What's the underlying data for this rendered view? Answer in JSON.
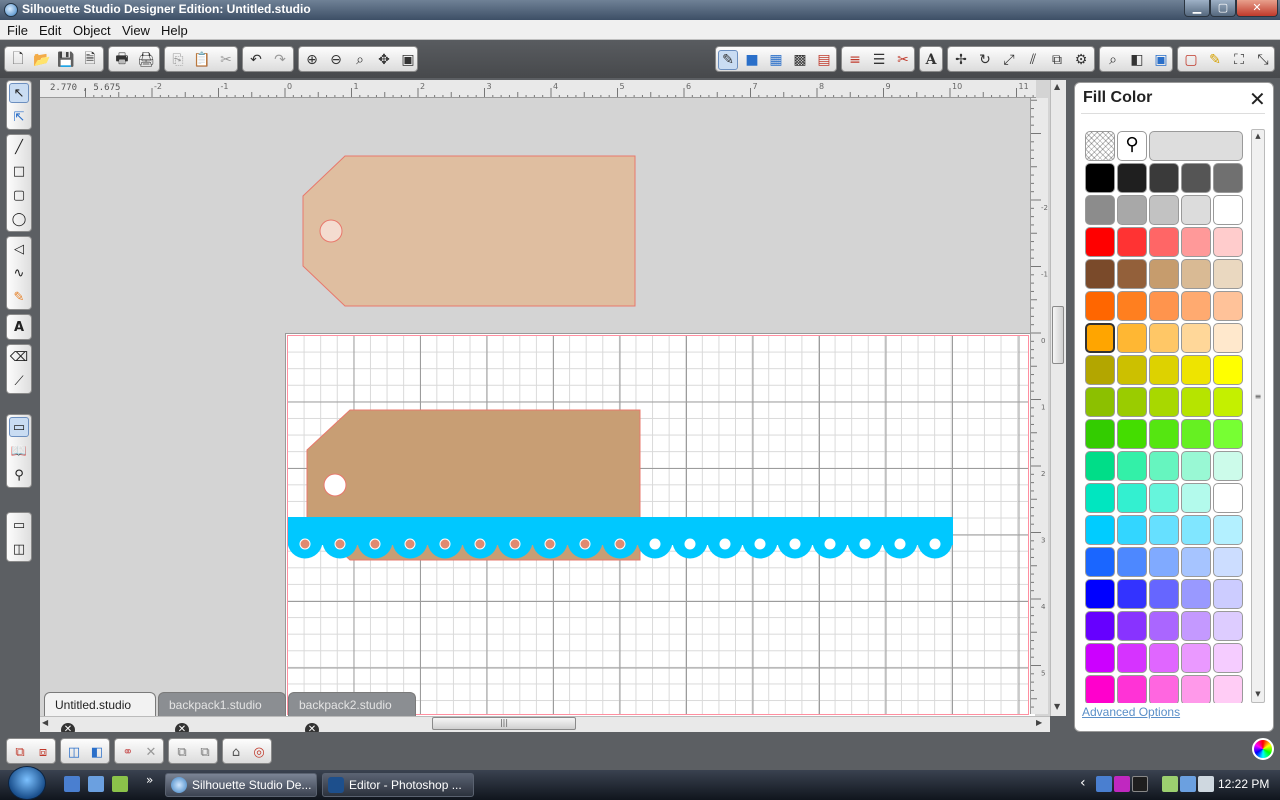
{
  "window": {
    "title": "Silhouette Studio Designer Edition: Untitled.studio",
    "min_label": "▁",
    "max_label": "▢",
    "close_label": "✕"
  },
  "menu": [
    "File",
    "Edit",
    "Object",
    "View",
    "Help"
  ],
  "ruler": {
    "coords": "2.770 , 5.675",
    "h_labels": [
      "-2",
      "-1",
      "0",
      "1",
      "2",
      "3",
      "4",
      "5",
      "6",
      "7",
      "8",
      "9",
      "10",
      "11"
    ],
    "v_labels": [
      "-2",
      "-1",
      "0",
      "1",
      "2",
      "3",
      "4",
      "5"
    ]
  },
  "tabs": [
    {
      "label": "Untitled.studio",
      "active": true
    },
    {
      "label": "backpack1.studio",
      "active": false
    },
    {
      "label": "backpack2.studio",
      "active": false
    }
  ],
  "fill_panel": {
    "title": "Fill Color",
    "close": "✕",
    "advanced": "Advanced Options",
    "selected_swatch": "#FFA500",
    "top_row": [
      "transparent",
      "eyedropper",
      "#DDDDDD"
    ],
    "palette": [
      [
        "#000000",
        "#1F1F1F",
        "#3A3A3A",
        "#555555",
        "#707070"
      ],
      [
        "#8C8C8C",
        "#A8A8A8",
        "#C2C2C2",
        "#DCDCDC",
        "#FFFFFF"
      ],
      [
        "#FF0000",
        "#FF3333",
        "#FF6666",
        "#FF9999",
        "#FFCCCC"
      ],
      [
        "#7A4A2A",
        "#93603A",
        "#C69C6D",
        "#D9BA94",
        "#EAD8C0"
      ],
      [
        "#FF6600",
        "#FF7F1F",
        "#FF944D",
        "#FFAA70",
        "#FFC299"
      ],
      [
        "#FFA500",
        "#FFB733",
        "#FFC766",
        "#FFD799",
        "#FFE8CC"
      ],
      [
        "#B3A600",
        "#CCC000",
        "#DDD200",
        "#EEE400",
        "#FFFF00"
      ],
      [
        "#8CC000",
        "#9ACC00",
        "#A8D800",
        "#B6E400",
        "#C4F000"
      ],
      [
        "#33CC00",
        "#44DD00",
        "#55E611",
        "#66F022",
        "#77FF33"
      ],
      [
        "#00DD88",
        "#33F0A8",
        "#66F5BF",
        "#99F8D4",
        "#CCFBEA"
      ],
      [
        "#00E6C0",
        "#33F0D0",
        "#66F5DC",
        "#B3FAEC",
        "#FFFFFF"
      ],
      [
        "#00CCFF",
        "#33D6FF",
        "#66E0FF",
        "#80E6FF",
        "#B3F0FF"
      ],
      [
        "#1A66FF",
        "#4D88FF",
        "#80AAFF",
        "#A6C4FF",
        "#CCDDFF"
      ],
      [
        "#0000FF",
        "#3333FF",
        "#6666FF",
        "#9999FF",
        "#CCCCFF"
      ],
      [
        "#6600FF",
        "#8833FF",
        "#AA66FF",
        "#C499FF",
        "#DDCCFF"
      ],
      [
        "#CC00FF",
        "#D633FF",
        "#E066FF",
        "#EA99FF",
        "#F5CCFF"
      ],
      [
        "#FF00CC",
        "#FF33D6",
        "#FF66E0",
        "#FF99EA",
        "#FFCCF5"
      ]
    ]
  },
  "taskbar": {
    "tasks": [
      "Silhouette Studio De...",
      "Editor - Photoshop ..."
    ],
    "clock": "12:22 PM",
    "chevron": "»",
    "tray_arrow": "‹"
  },
  "shapes": {
    "tag_fill_top": "#DFBEA0",
    "tag_fill_bottom": "#C89E74",
    "tag_stroke": "#E8786C",
    "border_fill": "#00C8FF"
  }
}
